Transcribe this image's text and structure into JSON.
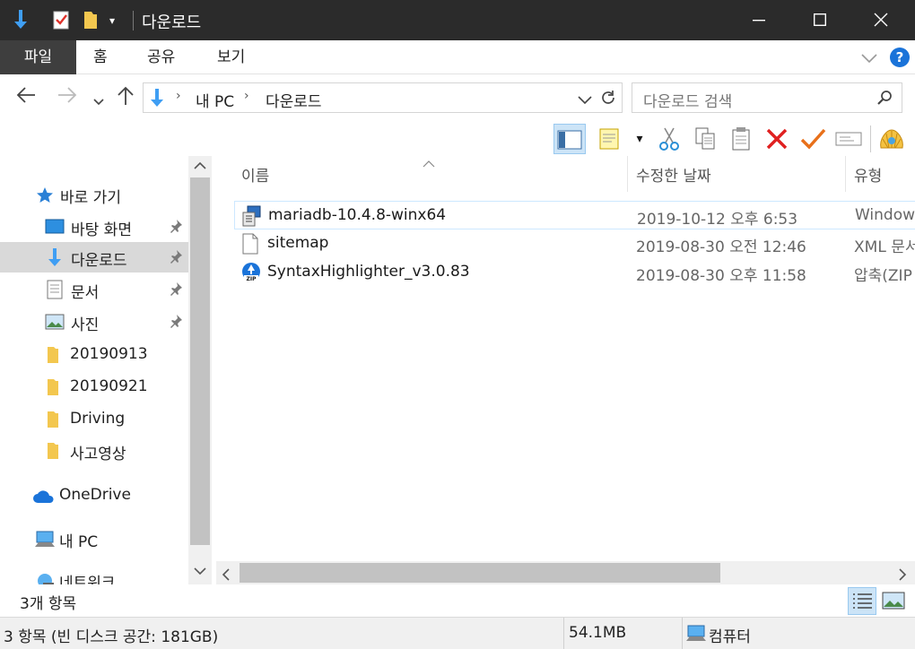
{
  "window": {
    "title": "다운로드"
  },
  "ribbon": {
    "tabs": [
      "파일",
      "홈",
      "공유",
      "보기"
    ]
  },
  "address": {
    "crumbs": [
      "내 PC",
      "다운로드"
    ]
  },
  "search": {
    "placeholder": "다운로드 검색"
  },
  "nav": {
    "quick_access": "바로 가기",
    "items": [
      "바탕 화면",
      "다운로드",
      "문서",
      "사진",
      "20190913",
      "20190921",
      "Driving",
      "사고영상"
    ],
    "onedrive": "OneDrive",
    "this_pc": "내 PC",
    "network": "네트워크"
  },
  "columns": {
    "name": "이름",
    "modified": "수정한 날짜",
    "type": "유형"
  },
  "files": [
    {
      "name": "mariadb-10.4.8-winx64",
      "modified": "2019-10-12 오후 6:53",
      "type": "Window"
    },
    {
      "name": "sitemap",
      "modified": "2019-08-30 오전 12:46",
      "type": "XML 문서"
    },
    {
      "name": "SyntaxHighlighter_v3.0.83",
      "modified": "2019-08-30 오후 11:58",
      "type": "압축(ZIP"
    }
  ],
  "item_count": "3개 항목",
  "status": {
    "summary": "3 항목 (빈 디스크 공간: 181GB)",
    "size": "54.1MB",
    "location": "컴퓨터"
  },
  "colors": {
    "accent": "#0a6ed1",
    "title_bar": "#2b2b2b",
    "selection": "#d9d9d9"
  }
}
